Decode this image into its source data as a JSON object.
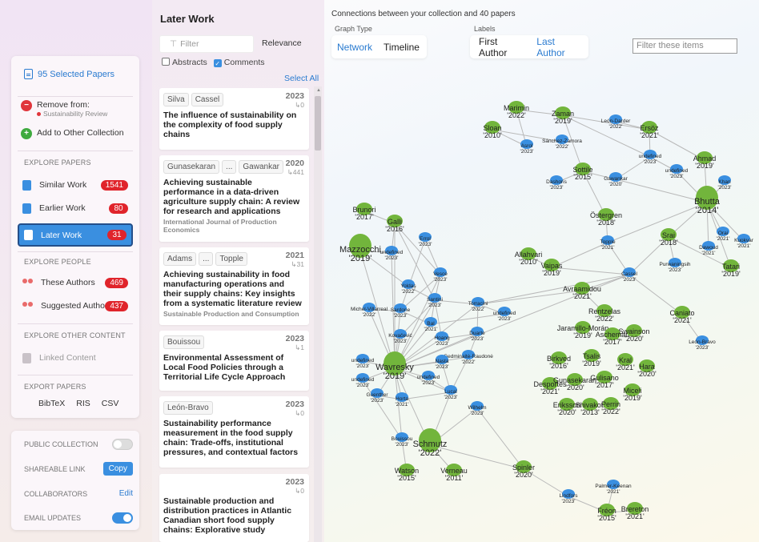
{
  "left": {
    "selected_papers": "95 Selected Papers",
    "remove_from": "Remove from:",
    "remove_collection": "Sustainability Review",
    "add_other": "Add to Other Collection",
    "explore_papers_header": "EXPLORE PAPERS",
    "nav_papers": [
      {
        "label": "Similar Work",
        "count": "1541"
      },
      {
        "label": "Earlier Work",
        "count": "80"
      },
      {
        "label": "Later Work",
        "count": "31"
      }
    ],
    "explore_people_header": "EXPLORE PEOPLE",
    "nav_people": [
      {
        "label": "These Authors",
        "count": "469"
      },
      {
        "label": "Suggested Authors",
        "count": "437"
      }
    ],
    "explore_other_header": "EXPLORE OTHER CONTENT",
    "linked_content": "Linked Content",
    "export_header": "EXPORT PAPERS",
    "export": [
      "BibTeX",
      "RIS",
      "CSV"
    ],
    "public_collection": "PUBLIC COLLECTION",
    "shareable_link": "SHAREABLE LINK",
    "copy": "Copy",
    "collaborators": "COLLABORATORS",
    "edit": "Edit",
    "email_updates": "EMAIL UPDATES"
  },
  "middle": {
    "title": "Later Work",
    "filter_placeholder": "Filter",
    "sort": "Relevance",
    "abstracts": "Abstracts",
    "comments": "Comments",
    "select_all": "Select All",
    "papers": [
      {
        "authors": [
          "Silva",
          "Cassel"
        ],
        "year": "2023",
        "cites": "↳0",
        "title": "The influence of sustainability on the complexity of food supply chains",
        "journal": ""
      },
      {
        "authors": [
          "Gunasekaran",
          "...",
          "Gawankar"
        ],
        "year": "2020",
        "cites": "↳441",
        "title": "Achieving sustainable performance in a data-driven agriculture supply chain: A review for research and applications",
        "journal": "International Journal of Production Economics"
      },
      {
        "authors": [
          "Adams",
          "...",
          "Topple"
        ],
        "year": "2021",
        "cites": "↳31",
        "title": "Achieving sustainability in food manufacturing operations and their supply chains: Key insights from a systematic literature review",
        "journal": "Sustainable Production and Consumption"
      },
      {
        "authors": [
          "Bouissou"
        ],
        "year": "2023",
        "cites": "↳1",
        "title": "Environmental Assessment of Local Food Policies through a Territorial Life Cycle Approach",
        "journal": ""
      },
      {
        "authors": [
          "León-Bravo"
        ],
        "year": "2023",
        "cites": "↳0",
        "title": "Sustainability performance measurement in the food supply chain: Trade-offs, institutional pressures, and contextual factors",
        "journal": ""
      },
      {
        "authors": [],
        "year": "2023",
        "cites": "↳0",
        "title": "Sustainable production and distribution practices in Atlantic Canadian short food supply chains: Explorative study",
        "journal": ""
      }
    ]
  },
  "graph": {
    "connections": "Connections between your collection and 40 papers",
    "graph_type_label": "Graph Type",
    "graph_types": [
      "Network",
      "Timeline"
    ],
    "labels_label": "Labels",
    "label_options": [
      "First Author",
      "Last Author"
    ],
    "filter_placeholder": "Filter these items",
    "colors": {
      "green": "#72b53c",
      "blue": "#3a8fe0",
      "edge": "#b9b9b9"
    },
    "nodes": [
      {
        "id": "marimin",
        "name": "Marimin",
        "year": "2022",
        "c": "g",
        "s": "m"
      },
      {
        "id": "zaman",
        "name": "Zaman",
        "year": "2019",
        "c": "g",
        "s": "m"
      },
      {
        "id": "leondarder",
        "name": "León-Darder",
        "year": "2022",
        "c": "b",
        "s": "s"
      },
      {
        "id": "ersoz",
        "name": "Ersöz",
        "year": "2021",
        "c": "g",
        "s": "m"
      },
      {
        "id": "sloan",
        "name": "Sloan",
        "year": "2010",
        "c": "g",
        "s": "m"
      },
      {
        "id": "asrol",
        "name": "Asrol",
        "year": "2023",
        "c": "b",
        "s": "s"
      },
      {
        "id": "sanchez",
        "name": "Sánchez-Zamora",
        "year": "2022",
        "c": "b",
        "s": "s"
      },
      {
        "id": "undef1",
        "name": "undefined",
        "year": "2023",
        "c": "b",
        "s": "s"
      },
      {
        "id": "ahmad",
        "name": "Ahmad",
        "year": "2019",
        "c": "g",
        "s": "m"
      },
      {
        "id": "undef2",
        "name": "undefined",
        "year": "2023",
        "c": "b",
        "s": "s"
      },
      {
        "id": "khan",
        "name": "Khan",
        "year": "2023",
        "c": "b",
        "s": "s"
      },
      {
        "id": "sottile",
        "name": "Sottile",
        "year": "2015",
        "c": "g",
        "s": "m"
      },
      {
        "id": "dashoris",
        "name": "Dashoris",
        "year": "2023",
        "c": "b",
        "s": "s"
      },
      {
        "id": "gawankar",
        "name": "Gawankar",
        "year": "2020",
        "c": "b",
        "s": "s"
      },
      {
        "id": "bhutta",
        "name": "Bhutta",
        "year": "2014",
        "c": "g",
        "s": "l"
      },
      {
        "id": "brunori",
        "name": "Brunori",
        "year": "2017",
        "c": "g",
        "s": "m"
      },
      {
        "id": "galli",
        "name": "Galli",
        "year": "2016",
        "c": "g",
        "s": "m"
      },
      {
        "id": "osterg",
        "name": "Östergren",
        "year": "2018",
        "c": "g",
        "s": "m"
      },
      {
        "id": "srai",
        "name": "Srai",
        "year": "2018",
        "c": "g",
        "s": "m"
      },
      {
        "id": "orai",
        "name": "Orai",
        "year": "2021",
        "c": "b",
        "s": "s"
      },
      {
        "id": "kuokvar",
        "name": "Kuokvar",
        "year": "2021",
        "c": "b",
        "s": "s"
      },
      {
        "id": "dawoud",
        "name": "Dawoud",
        "year": "2021",
        "c": "b",
        "s": "s"
      },
      {
        "id": "mazzocchi",
        "name": "Mazzocchi",
        "year": "2019",
        "c": "g",
        "s": "l"
      },
      {
        "id": "undef3",
        "name": "undefined",
        "year": "2023",
        "c": "b",
        "s": "s"
      },
      {
        "id": "errol",
        "name": "Errol",
        "year": "2023",
        "c": "b",
        "s": "s"
      },
      {
        "id": "topple",
        "name": "Topple",
        "year": "2021",
        "c": "b",
        "s": "s"
      },
      {
        "id": "allahvari",
        "name": "Allahvari",
        "year": "2010",
        "c": "g",
        "s": "m"
      },
      {
        "id": "purwaningsih",
        "name": "Purwaningsih",
        "year": "2023",
        "c": "b",
        "s": "s"
      },
      {
        "id": "tatari",
        "name": "Tatari",
        "year": "2019",
        "c": "g",
        "s": "m"
      },
      {
        "id": "vaipas",
        "name": "Vaipas",
        "year": "2019",
        "c": "g",
        "s": "m"
      },
      {
        "id": "cassel",
        "name": "Cassel",
        "year": "2023",
        "c": "b",
        "s": "s"
      },
      {
        "id": "yoldas",
        "name": "Yoldaş",
        "year": "2022",
        "c": "b",
        "s": "s"
      },
      {
        "id": "vesce",
        "name": "Vesce",
        "year": "2023",
        "c": "b",
        "s": "s"
      },
      {
        "id": "avraamidou",
        "name": "Avraamidou",
        "year": "2021",
        "c": "g",
        "s": "m"
      },
      {
        "id": "santini",
        "name": "Santini",
        "year": "2023",
        "c": "b",
        "s": "s"
      },
      {
        "id": "michelv",
        "name": "Michel-Villarreal",
        "year": "2022",
        "c": "b",
        "s": "s"
      },
      {
        "id": "sardone",
        "name": "Sardone",
        "year": "2023",
        "c": "b",
        "s": "s"
      },
      {
        "id": "torracini",
        "name": "Torracini",
        "year": "2022",
        "c": "b",
        "s": "s"
      },
      {
        "id": "undef4",
        "name": "undefined",
        "year": "2023",
        "c": "b",
        "s": "s"
      },
      {
        "id": "rentzelas",
        "name": "Rentzelas",
        "year": "2022",
        "c": "g",
        "s": "m"
      },
      {
        "id": "caniato",
        "name": "Caniato",
        "year": "2021",
        "c": "g",
        "s": "m"
      },
      {
        "id": "bal",
        "name": "Bal",
        "year": "2021",
        "c": "b",
        "s": "s"
      },
      {
        "id": "jaramillo",
        "name": "Jaramillo-Morán",
        "year": "2019",
        "c": "g",
        "s": "m"
      },
      {
        "id": "ascheman",
        "name": "Ascheman",
        "year": "2017",
        "c": "g",
        "s": "m"
      },
      {
        "id": "swainson",
        "name": "Swainson",
        "year": "2020",
        "c": "g",
        "s": "m"
      },
      {
        "id": "kovacevic",
        "name": "Kovačević",
        "year": "2023",
        "c": "b",
        "s": "s"
      },
      {
        "id": "hoang",
        "name": "Hoang",
        "year": "2023",
        "c": "b",
        "s": "s"
      },
      {
        "id": "duarte",
        "name": "Duarte",
        "year": "2023",
        "c": "b",
        "s": "s"
      },
      {
        "id": "leonbravo",
        "name": "León-Bravo",
        "year": "2023",
        "c": "b",
        "s": "s"
      },
      {
        "id": "gedminaite",
        "name": "Gedminaitė-Raudonė",
        "year": "2022",
        "c": "b",
        "s": "s"
      },
      {
        "id": "undef5",
        "name": "undefined",
        "year": "2023",
        "c": "b",
        "s": "s"
      },
      {
        "id": "wavresky",
        "name": "Wavresky",
        "year": "2019",
        "c": "g",
        "s": "l"
      },
      {
        "id": "nasta",
        "name": "Nasta",
        "year": "2023",
        "c": "b",
        "s": "s"
      },
      {
        "id": "tsalis",
        "name": "Tsalis",
        "year": "2019",
        "c": "g",
        "s": "m"
      },
      {
        "id": "kral",
        "name": "Kral",
        "year": "2021",
        "c": "g",
        "s": "m"
      },
      {
        "id": "birkved",
        "name": "Birkved",
        "year": "2016",
        "c": "g",
        "s": "m"
      },
      {
        "id": "hara",
        "name": "Hara",
        "year": "2020",
        "c": "g",
        "s": "m"
      },
      {
        "id": "undef6",
        "name": "undefined",
        "year": "2023",
        "c": "b",
        "s": "s"
      },
      {
        "id": "undef7",
        "name": "undefined",
        "year": "2023",
        "c": "b",
        "s": "s"
      },
      {
        "id": "desportes",
        "name": "Desportes",
        "year": "2021",
        "c": "g",
        "s": "m"
      },
      {
        "id": "gunasekaran",
        "name": "Gunasekaran",
        "year": "2020",
        "c": "g",
        "s": "m"
      },
      {
        "id": "gulisano",
        "name": "Gulisano",
        "year": "2017",
        "c": "g",
        "s": "m"
      },
      {
        "id": "guenther",
        "name": "Guenther",
        "year": "2023",
        "c": "b",
        "s": "s"
      },
      {
        "id": "lucal",
        "name": "Lucal",
        "year": "2023",
        "c": "b",
        "s": "s"
      },
      {
        "id": "horta",
        "name": "Horta",
        "year": "2021",
        "c": "b",
        "s": "s"
      },
      {
        "id": "miceli",
        "name": "Miceli",
        "year": "2019",
        "c": "g",
        "s": "m"
      },
      {
        "id": "wilhelm",
        "name": "Wilhelm",
        "year": "2023",
        "c": "b",
        "s": "s"
      },
      {
        "id": "eriksson",
        "name": "Eriksson",
        "year": "2020",
        "c": "g",
        "s": "m"
      },
      {
        "id": "shivakoti",
        "name": "Shivakoti",
        "year": "2013",
        "c": "g",
        "s": "m"
      },
      {
        "id": "perrin",
        "name": "Perrin",
        "year": "2022",
        "c": "g",
        "s": "m"
      },
      {
        "id": "bouissou",
        "name": "Bouissou",
        "year": "2023",
        "c": "b",
        "s": "s"
      },
      {
        "id": "schmutz",
        "name": "Schmutz",
        "year": "2022",
        "c": "g",
        "s": "l"
      },
      {
        "id": "spinler",
        "name": "Spinler",
        "year": "2020",
        "c": "g",
        "s": "m"
      },
      {
        "id": "watson",
        "name": "Watson",
        "year": "2015",
        "c": "g",
        "s": "m"
      },
      {
        "id": "verneau",
        "name": "Verneau",
        "year": "2011",
        "c": "g",
        "s": "m"
      },
      {
        "id": "palmerkeenan",
        "name": "Palmer-Keenan",
        "year": "2021",
        "c": "b",
        "s": "s"
      },
      {
        "id": "lindfors",
        "name": "Lindfors",
        "year": "2023",
        "c": "b",
        "s": "s"
      },
      {
        "id": "freon",
        "name": "Fréon",
        "year": "2015",
        "c": "g",
        "s": "m"
      },
      {
        "id": "brereton",
        "name": "Brereton",
        "year": "2021",
        "c": "g",
        "s": "m"
      }
    ],
    "edges": [
      [
        "marimin",
        "zaman"
      ],
      [
        "zaman",
        "sottile"
      ],
      [
        "zaman",
        "ersoz"
      ],
      [
        "marimin",
        "asrol"
      ],
      [
        "sloan",
        "asrol"
      ],
      [
        "sloan",
        "sanchez"
      ],
      [
        "zaman",
        "undef1"
      ],
      [
        "leondarder",
        "ersoz"
      ],
      [
        "ersoz",
        "undef1"
      ],
      [
        "ersoz",
        "ahmad"
      ],
      [
        "undef1",
        "gawankar"
      ],
      [
        "undef1",
        "undef2"
      ],
      [
        "ahmad",
        "bhutta"
      ],
      [
        "khan",
        "bhutta"
      ],
      [
        "undef2",
        "bhutta"
      ],
      [
        "sottile",
        "dashoris"
      ],
      [
        "sottile",
        "gawankar"
      ],
      [
        "sottile",
        "osterg"
      ],
      [
        "gawankar",
        "bhutta"
      ],
      [
        "bhutta",
        "srai"
      ],
      [
        "bhutta",
        "orai"
      ],
      [
        "bhutta",
        "kuokvar"
      ],
      [
        "bhutta",
        "dawoud"
      ],
      [
        "bhutta",
        "tatari"
      ],
      [
        "bhutta",
        "topple"
      ],
      [
        "srai",
        "cassel"
      ],
      [
        "srai",
        "purwaningsih"
      ],
      [
        "srai",
        "tatari"
      ],
      [
        "topple",
        "cassel"
      ],
      [
        "osterg",
        "topple"
      ],
      [
        "cassel",
        "avraamidou"
      ],
      [
        "cassel",
        "caniato"
      ],
      [
        "cassel",
        "vaipas"
      ],
      [
        "cassel",
        "torracini"
      ],
      [
        "caniato",
        "leonbravo"
      ],
      [
        "avraamidou",
        "rentzelas"
      ],
      [
        "avraamidou",
        "torracini"
      ],
      [
        "mazzocchi",
        "undef3"
      ],
      [
        "mazzocchi",
        "yoldas"
      ],
      [
        "mazzocchi",
        "wavresky"
      ],
      [
        "brunori",
        "galli"
      ],
      [
        "galli",
        "vesce"
      ],
      [
        "errol",
        "vesce"
      ],
      [
        "galli",
        "santini"
      ],
      [
        "vesce",
        "santini"
      ],
      [
        "vesce",
        "sardone"
      ],
      [
        "santini",
        "torracini"
      ],
      [
        "santini",
        "bal"
      ],
      [
        "santini",
        "hoang"
      ],
      [
        "torracini",
        "undef4"
      ],
      [
        "torracini",
        "duarte"
      ],
      [
        "michelv",
        "wavresky"
      ],
      [
        "sardone",
        "wavresky"
      ],
      [
        "kovacevic",
        "wavresky"
      ],
      [
        "bal",
        "wavresky"
      ],
      [
        "hoang",
        "wavresky"
      ],
      [
        "duarte",
        "wavresky"
      ],
      [
        "gedminaite",
        "wavresky"
      ],
      [
        "nasta",
        "wavresky"
      ],
      [
        "undef5",
        "wavresky"
      ],
      [
        "undef6",
        "wavresky"
      ],
      [
        "undef7",
        "wavresky"
      ],
      [
        "guenther",
        "wavresky"
      ],
      [
        "horta",
        "wavresky"
      ],
      [
        "lucal",
        "wavresky"
      ],
      [
        "wavresky",
        "schmutz"
      ],
      [
        "wavresky",
        "bouissou"
      ],
      [
        "wilhelm",
        "schmutz"
      ],
      [
        "lucal",
        "schmutz"
      ],
      [
        "bouissou",
        "watson"
      ],
      [
        "schmutz",
        "verneau"
      ],
      [
        "schmutz",
        "spinler"
      ],
      [
        "wilhelm",
        "spinler"
      ],
      [
        "spinler",
        "lindfors"
      ],
      [
        "lindfors",
        "freon"
      ],
      [
        "palmerkeenan",
        "freon"
      ],
      [
        "freon",
        "brereton"
      ],
      [
        "torracini",
        "wavresky"
      ],
      [
        "santini",
        "wavresky"
      ],
      [
        "vesce",
        "wavresky"
      ],
      [
        "galli",
        "wavresky"
      ],
      [
        "undef3",
        "wavresky"
      ],
      [
        "yoldas",
        "santini"
      ],
      [
        "duarte",
        "gedminaite"
      ],
      [
        "undef4",
        "bal"
      ],
      [
        "cassel",
        "wavresky"
      ],
      [
        "topple",
        "vaipas"
      ],
      [
        "kovacevic",
        "santini"
      ],
      [
        "sardone",
        "bal"
      ],
      [
        "galli",
        "undef3"
      ],
      [
        "hoang",
        "duarte"
      ],
      [
        "horta",
        "lucal"
      ],
      [
        "gedminaite",
        "lucal"
      ],
      [
        "nasta",
        "lucal"
      ],
      [
        "undef6",
        "bouissou"
      ],
      [
        "undef7",
        "lucal"
      ],
      [
        "guenther",
        "horta"
      ],
      [
        "allahvari",
        "vaipas"
      ],
      [
        "michelv",
        "sardone"
      ],
      [
        "errol",
        "sardone"
      ]
    ]
  }
}
